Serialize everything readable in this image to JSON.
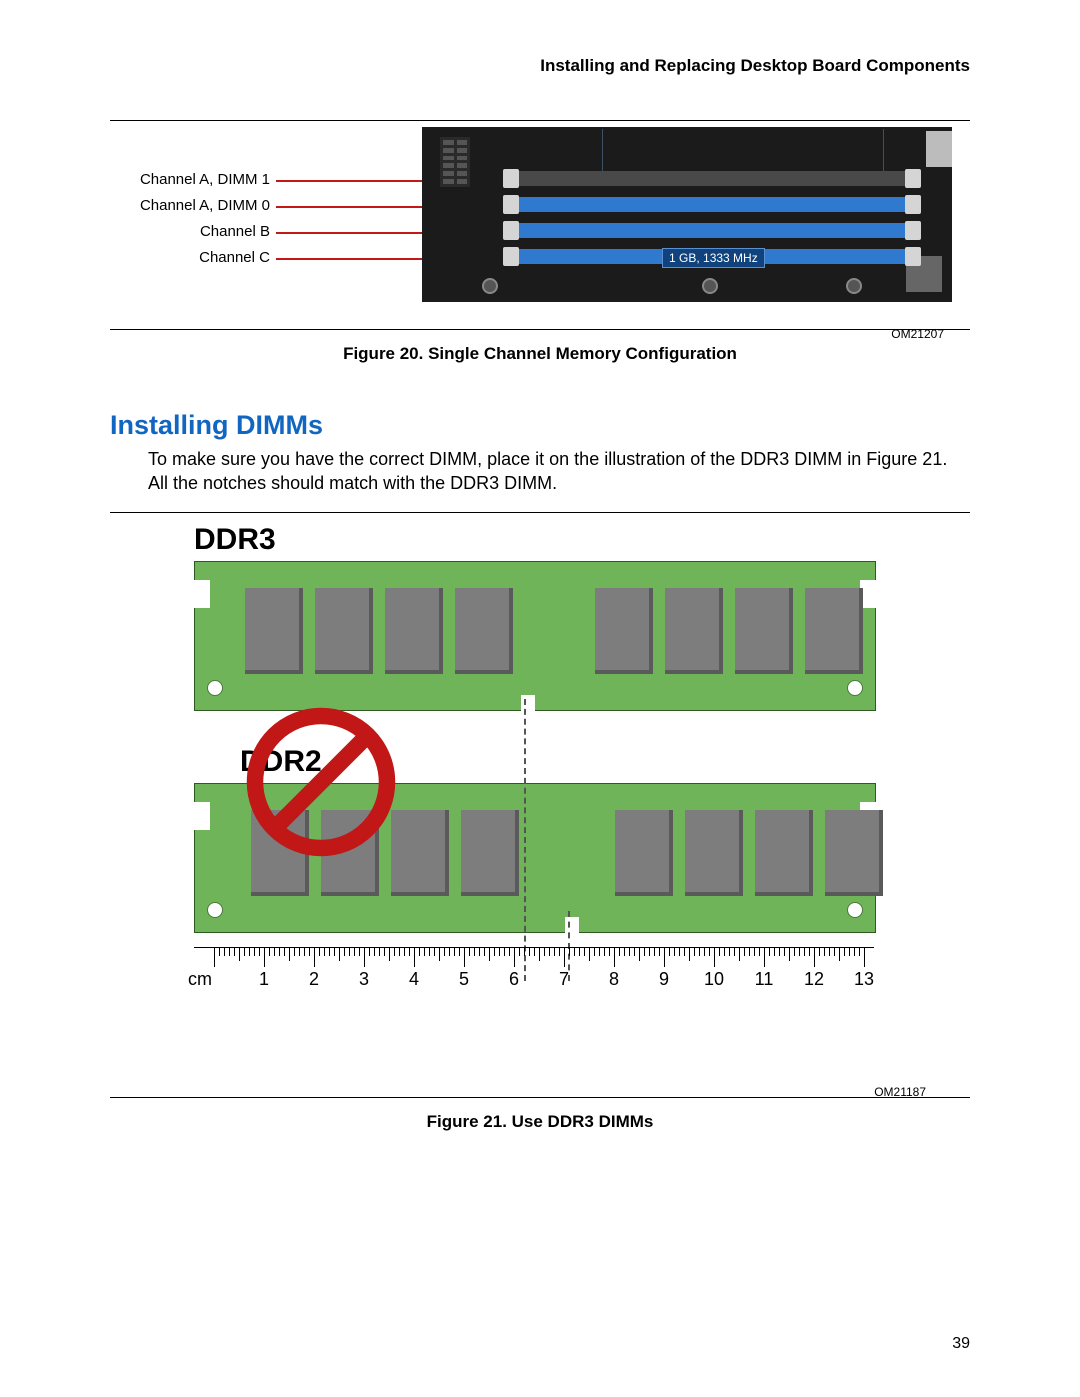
{
  "running_head": "Installing and Replacing Desktop Board Components",
  "page_number": "39",
  "section_heading": "Installing DIMMs",
  "paragraph": "To make sure you have the correct DIMM, place it on the illustration of the DDR3 DIMM in Figure 21.  All the notches should match with the DDR3 DIMM.",
  "figure20": {
    "caption": "Figure 20.  Single Channel Memory Configuration",
    "image_id": "OM21207",
    "labels": {
      "a1": "Channel A, DIMM 1",
      "a0": "Channel A, DIMM 0",
      "b": "Channel B",
      "c": "Channel C"
    },
    "populated_slot_label": "1 GB, 1333 MHz"
  },
  "figure21": {
    "caption": "Figure 21.  Use DDR3 DIMMs",
    "image_id": "OM21187",
    "good_label": "DDR3",
    "bad_label": "DDR2",
    "ruler_unit": "cm",
    "ruler_marks": [
      "1",
      "2",
      "3",
      "4",
      "5",
      "6",
      "7",
      "8",
      "9",
      "10",
      "11",
      "12",
      "13"
    ]
  }
}
